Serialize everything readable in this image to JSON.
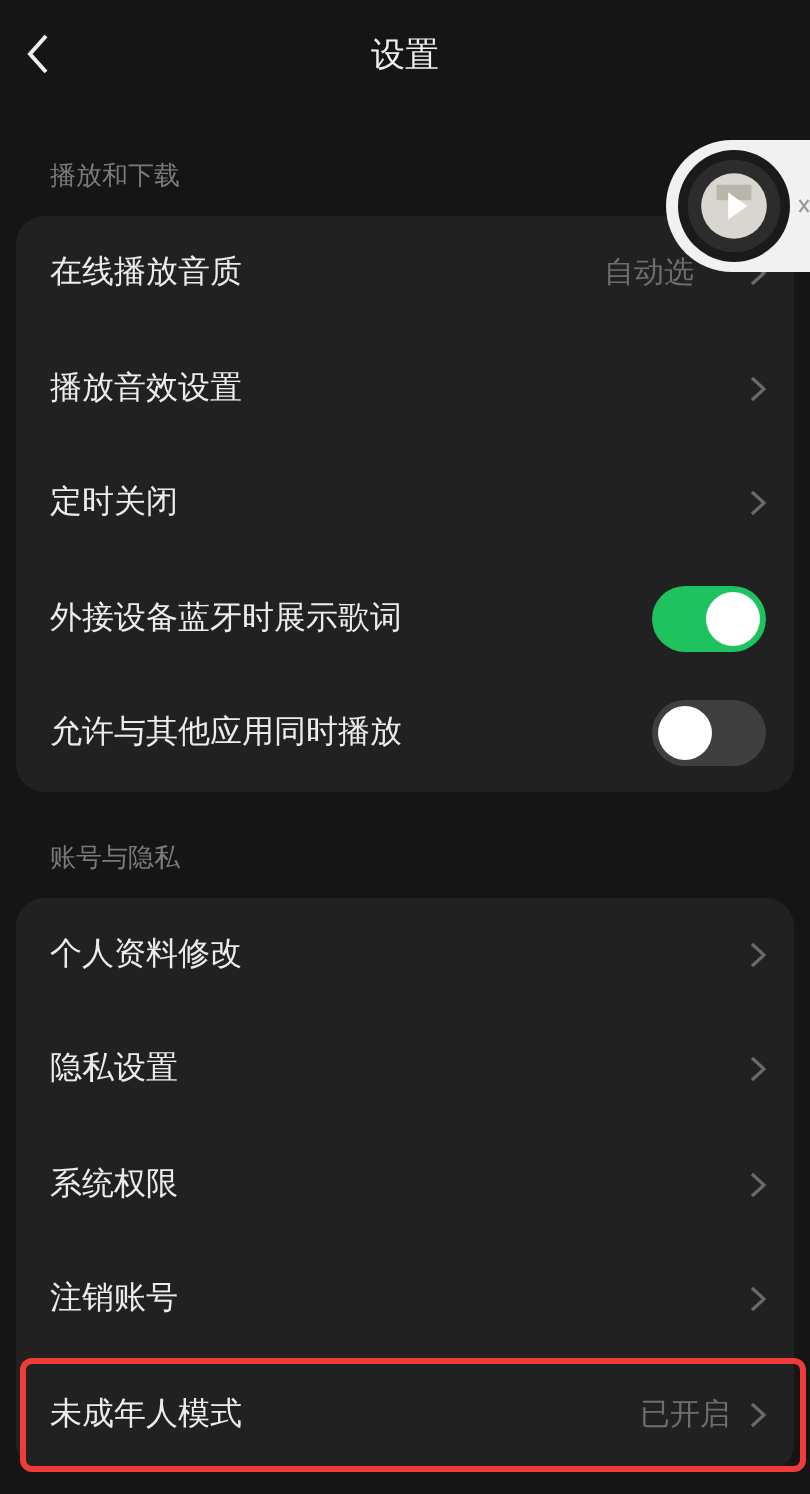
{
  "header": {
    "title": "设置"
  },
  "sections": [
    {
      "title": "播放和下载",
      "rows": [
        {
          "kind": "link",
          "label": "在线播放音质",
          "value": "自动选",
          "highlighted": false
        },
        {
          "kind": "link",
          "label": "播放音效设置",
          "highlighted": false
        },
        {
          "kind": "link",
          "label": "定时关闭",
          "highlighted": false
        },
        {
          "kind": "toggle",
          "label": "外接设备蓝牙时展示歌词",
          "on": true,
          "highlighted": false
        },
        {
          "kind": "toggle",
          "label": "允许与其他应用同时播放",
          "on": false,
          "highlighted": false
        }
      ]
    },
    {
      "title": "账号与隐私",
      "rows": [
        {
          "kind": "link",
          "label": "个人资料修改",
          "highlighted": false
        },
        {
          "kind": "link",
          "label": "隐私设置",
          "highlighted": false
        },
        {
          "kind": "link",
          "label": "系统权限",
          "highlighted": false
        },
        {
          "kind": "link",
          "label": "注销账号",
          "highlighted": false
        },
        {
          "kind": "link",
          "label": "未成年人模式",
          "value": "已开启",
          "highlighted": true
        }
      ]
    }
  ]
}
